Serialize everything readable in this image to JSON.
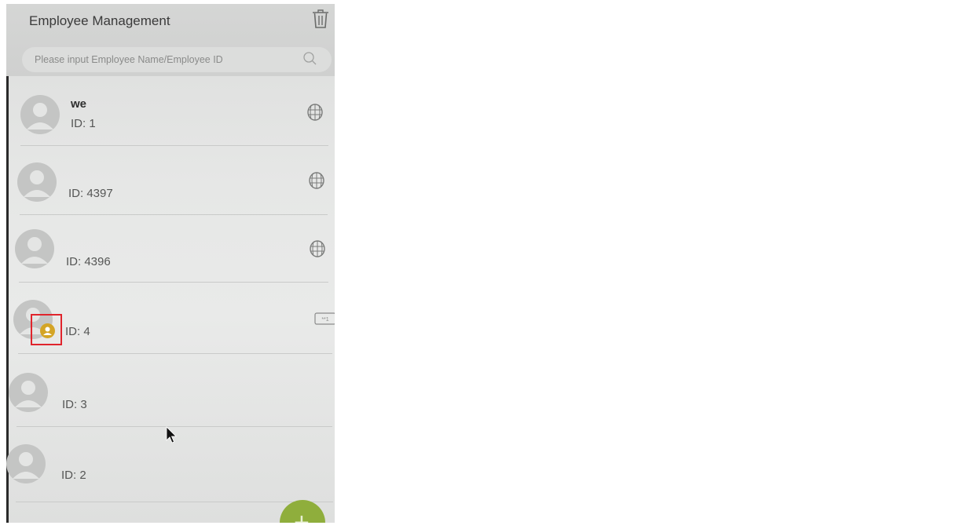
{
  "header": {
    "title": "Employee Management",
    "delete_icon": "trash-icon"
  },
  "search": {
    "placeholder": "Please input Employee Name/Employee ID",
    "icon": "search-icon"
  },
  "employees": [
    {
      "name": "we",
      "id_text": "ID: 1",
      "verify_icon": "face-icon",
      "is_admin": false
    },
    {
      "name": "",
      "id_text": "ID: 4397",
      "verify_icon": "face-icon",
      "is_admin": false
    },
    {
      "name": "",
      "id_text": "ID: 4396",
      "verify_icon": "face-icon",
      "is_admin": false
    },
    {
      "name": "",
      "id_text": "ID: 4",
      "verify_icon": "password-icon",
      "password_mask": "**1",
      "is_admin": true
    },
    {
      "name": "",
      "id_text": "ID: 3",
      "verify_icon": "",
      "is_admin": false
    },
    {
      "name": "",
      "id_text": "ID: 2",
      "verify_icon": "",
      "is_admin": false
    }
  ],
  "fab": {
    "icon": "plus-icon",
    "label": "+"
  },
  "colors": {
    "accent_fab": "#8fae3c",
    "admin_badge": "#d4a526",
    "highlight": "#e0242c"
  }
}
